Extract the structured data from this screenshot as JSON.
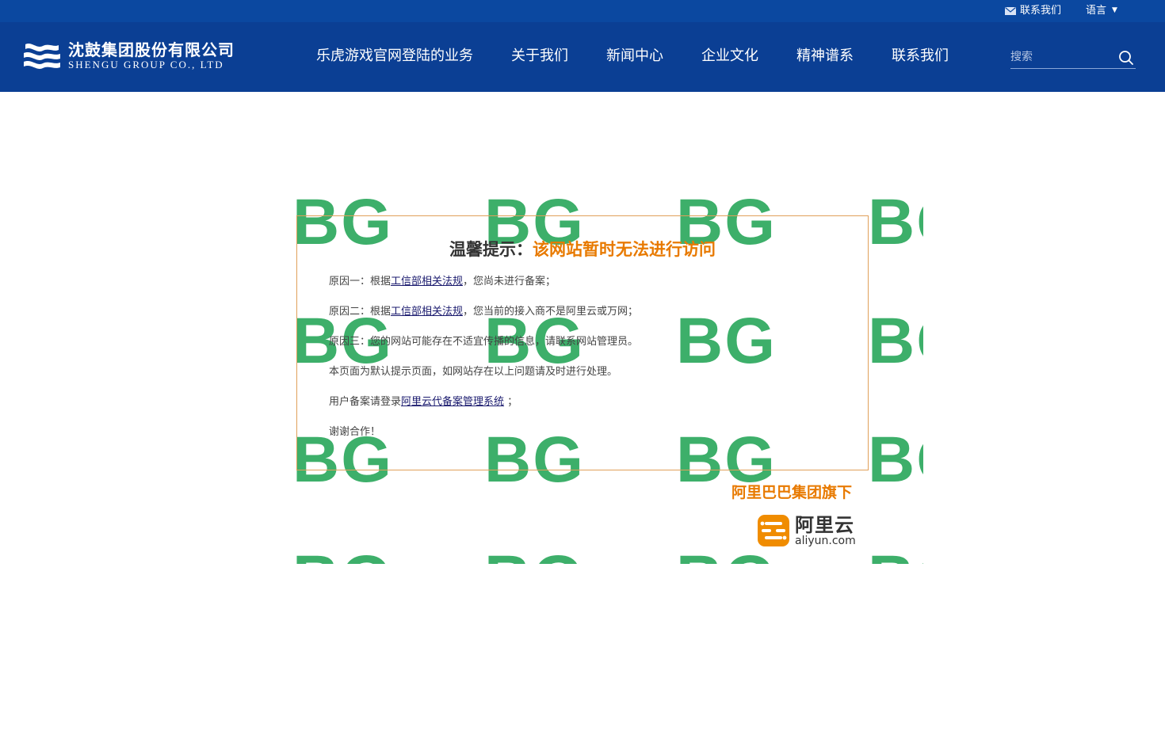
{
  "topbar": {
    "contact_label": "联系我们",
    "language_label": "语言"
  },
  "header": {
    "logo": {
      "name_cn": "沈鼓集团股份有限公司",
      "name_en": "SHENGU GROUP CO., LTD"
    },
    "nav": [
      "乐虎游戏官网登陆的业务",
      "关于我们",
      "新闻中心",
      "企业文化",
      "精神谱系",
      "联系我们"
    ],
    "search": {
      "placeholder": "搜索"
    }
  },
  "notice": {
    "title_prefix": "温馨提示：",
    "title_highlight": "该网站暂时无法进行访问",
    "reason1": {
      "before": "原因一：根据",
      "link": "工信部相关法规",
      "after": "，您尚未进行备案；"
    },
    "reason2": {
      "before": "原因二：根据",
      "link": "工信部相关法规",
      "after": "，您当前的接入商不是阿里云或万网；"
    },
    "reason3": "原因三：您的网站可能存在不适宜传播的信息，请联系网站管理员。",
    "line4": "本页面为默认提示页面，如网站存在以上问题请及时进行处理。",
    "line5": {
      "before": "用户备案请登录",
      "link": "阿里云代备案管理系统",
      "after": " ；"
    },
    "line6": "谢谢合作！"
  },
  "brand": {
    "tagline": "阿里巴巴集团旗下",
    "logo_cn": "阿里云",
    "logo_en": "aliyun.com"
  },
  "watermark": {
    "text": "BG",
    "color": "#3daf6a"
  },
  "colors": {
    "header_bg": "#0b3f94",
    "topbar_bg": "#0b48a0",
    "accent_orange": "#e87a00",
    "box_border": "#e0a05a"
  }
}
